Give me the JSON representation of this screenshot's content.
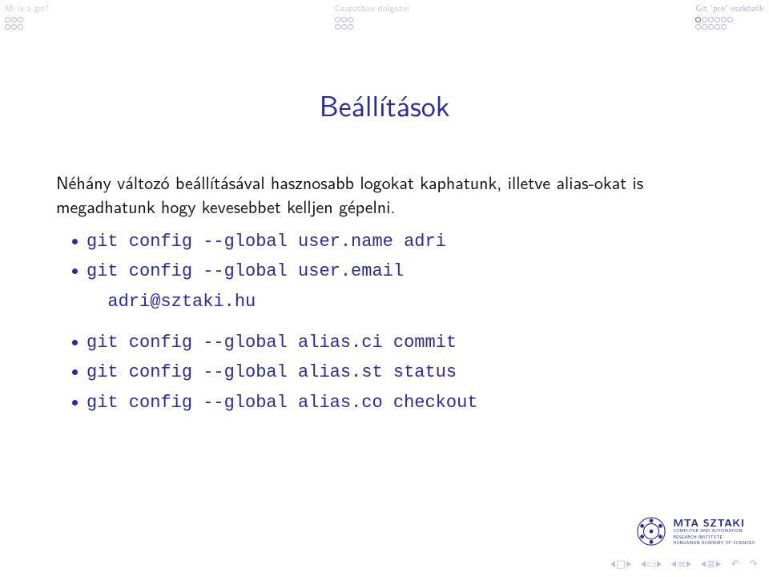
{
  "sections": [
    {
      "label": "Mi is a git?",
      "dots": [
        [
          1,
          1,
          1
        ],
        [
          1,
          1,
          1
        ]
      ]
    },
    {
      "label": "Csapatban dolgozni",
      "dots": [
        [
          1,
          1,
          1
        ],
        [
          1,
          1,
          1
        ]
      ]
    },
    {
      "label": "Git 'pro' eszközök",
      "dots": [
        [
          1,
          1,
          1,
          1,
          1,
          1
        ],
        [
          1,
          1,
          1,
          1,
          1
        ]
      ]
    }
  ],
  "title": "Beállítások",
  "paragraph": "Néhány változó beállításával hasznosabb logokat kaphatunk, illetve alias-okat is megadhatunk hogy kevesebbet kelljen gépelni.",
  "items_group1": [
    "git config --global user.name adri",
    "git config --global user.email\n  adri@sztaki.hu"
  ],
  "items_group2": [
    "git config --global alias.ci commit",
    "git config --global alias.st status",
    "git config --global alias.co checkout"
  ],
  "logo": {
    "name": "MTA SZTAKI",
    "sub1": "COMPUTER AND AUTOMATION",
    "sub2": "RESEARCH INSTITUTE",
    "sub3": "HUNGARIAN ACADEMY OF SCIENCES"
  }
}
